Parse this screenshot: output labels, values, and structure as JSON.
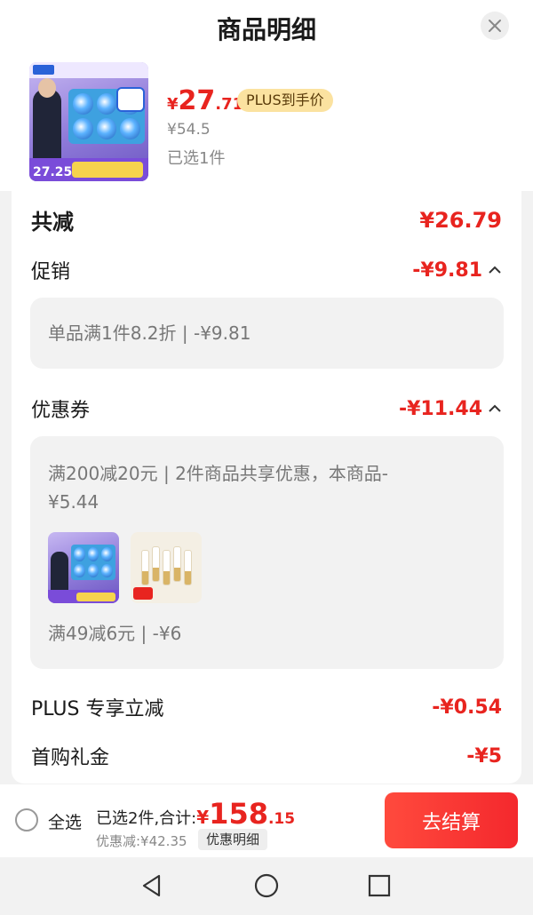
{
  "header": {
    "title": "商品明细"
  },
  "product": {
    "price_symbol": "¥",
    "price_int": "27",
    "price_dec": ".71",
    "plus_label": "PLUS到手价",
    "original_price": "¥54.5",
    "selected_count": "已选1件",
    "image_price_text": "27.25"
  },
  "breakdown": {
    "total": {
      "label": "共减",
      "amount": "¥26.79"
    },
    "promotion": {
      "label": "促销",
      "amount": "-¥9.81",
      "detail": "单品满1件8.2折 | -¥9.81"
    },
    "coupon": {
      "label": "优惠券",
      "amount": "-¥11.44",
      "detail_1": "满200减20元 | 2件商品共享优惠，本商品-¥5.44",
      "detail_2": "满49减6元 | -¥6"
    },
    "plus_discount": {
      "label": "PLUS 专享立减",
      "amount": "-¥0.54"
    },
    "first_purchase": {
      "label": "首购礼金",
      "amount": "-¥5"
    }
  },
  "footer": {
    "select_all": "全选",
    "summary_prefix": "已选2件,合计:",
    "total_symbol": "¥",
    "total_int": "158",
    "total_dec": ".15",
    "saving": "优惠减:¥42.35",
    "detail_button": "优惠明细",
    "checkout": "去结算"
  },
  "colors": {
    "accent": "#e8241f",
    "plus_badge": "#fbe2a0",
    "checkout": "#f4282d"
  },
  "icons": {
    "close": "close-icon",
    "chevron": "chevron-up-icon",
    "nav_back": "back-triangle-icon",
    "nav_home": "home-circle-icon",
    "nav_recent": "recent-square-icon"
  }
}
